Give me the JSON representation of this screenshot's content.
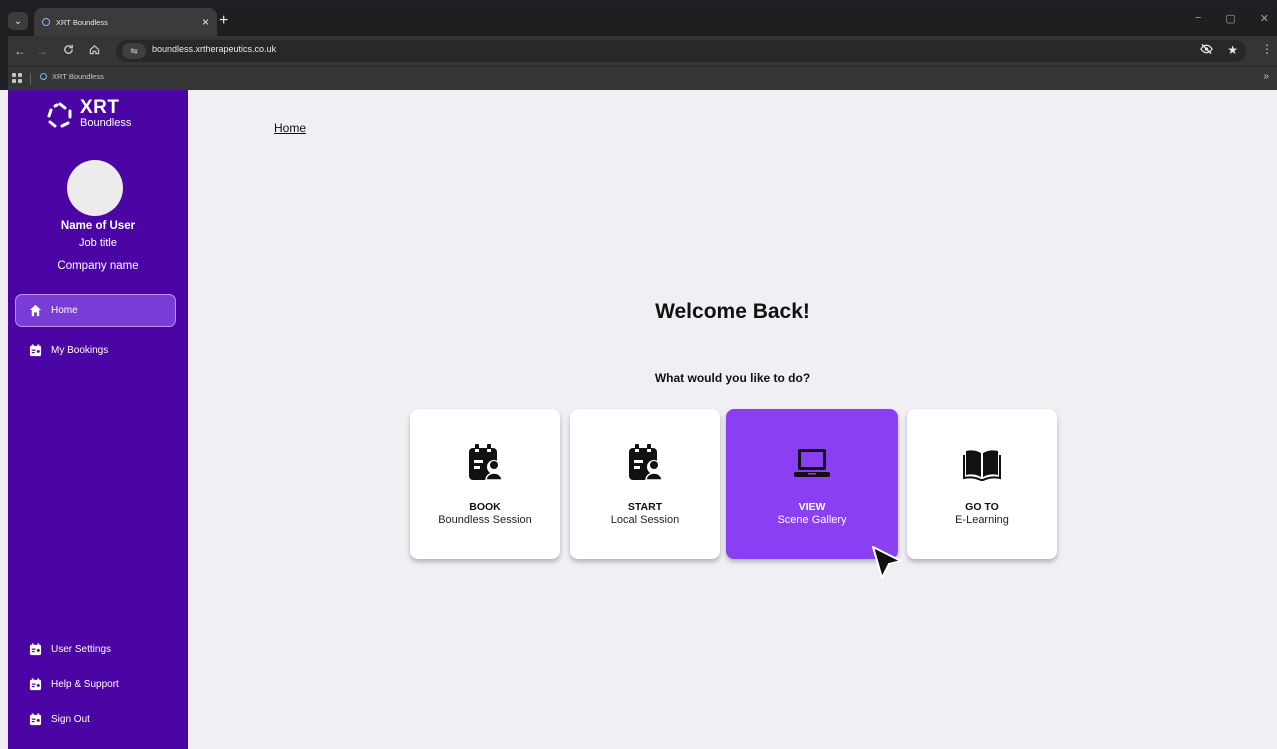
{
  "browser": {
    "tab_title": "XRT Boundless",
    "tab_close": "×",
    "new_tab": "+",
    "tab_list": "⌄",
    "url": "boundless.xrtherapeutics.co.uk",
    "bookmark_label": "XRT Boundless",
    "bookmarks_overflow": "»",
    "window_controls": [
      "−",
      "▢",
      "✕"
    ],
    "icons": [
      "back-icon",
      "forward-icon",
      "reload-icon",
      "home-icon",
      "site-info-icon",
      "eye-off-icon",
      "star-icon",
      "menu-icon",
      "apps-icon"
    ]
  },
  "sidebar": {
    "logo_title": "XRT",
    "logo_subtitle": "Boundless",
    "user_name": "Name of User",
    "job_title": "Job title",
    "company": "Company name",
    "nav": [
      {
        "label": "Home",
        "icon": "home-icon",
        "active": true
      },
      {
        "label": "My Bookings",
        "icon": "bookings-icon",
        "active": false
      }
    ],
    "bottom_nav": [
      {
        "label": "User Settings",
        "icon": "settings-icon"
      },
      {
        "label": "Help & Support",
        "icon": "help-icon"
      },
      {
        "label": "Sign Out",
        "icon": "sign-out-icon"
      }
    ],
    "colors": {
      "background": "#4b05a4",
      "active_item": "#7a3cd6"
    }
  },
  "main": {
    "breadcrumb": "Home",
    "welcome": "Welcome Back!",
    "question": "What would you like to do?",
    "cards": [
      {
        "action": "BOOK",
        "subtitle": "Boundless Session",
        "icon": "calendar-user-icon",
        "highlighted": false
      },
      {
        "action": "START",
        "subtitle": "Local Session",
        "icon": "calendar-user-icon",
        "highlighted": false
      },
      {
        "action": "VIEW",
        "subtitle": "Scene Gallery",
        "icon": "laptop-icon",
        "highlighted": true
      },
      {
        "action": "GO TO",
        "subtitle": "E-Learning",
        "icon": "book-icon",
        "highlighted": false
      }
    ],
    "colors": {
      "highlight_card": "#8a3ff3",
      "background": "#f0eff4"
    }
  }
}
